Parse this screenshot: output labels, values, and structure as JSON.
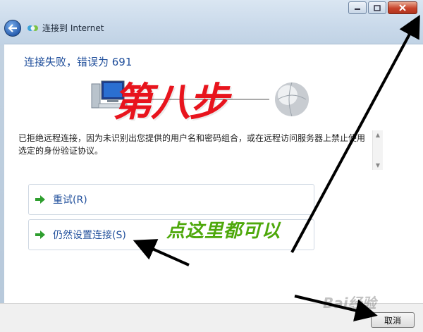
{
  "window": {
    "title": "连接到 Internet",
    "minimize_icon": "minimize-icon",
    "maximize_icon": "maximize-icon",
    "close_icon": "close-icon"
  },
  "page": {
    "heading": "连接失败，错误为 691",
    "message": "已拒绝远程连接，因为未识别出您提供的用户名和密码组合，或在远程访问服务器上禁止使用选定的身份验证协议。",
    "options": [
      {
        "label": "重试(R)",
        "icon": "green-arrow-icon"
      },
      {
        "label": "仍然设置连接(S)",
        "icon": "green-arrow-icon"
      }
    ],
    "cancel_label": "取消"
  },
  "annotations": {
    "step_text": "第八步",
    "hint_text": "点这里都可以"
  },
  "watermark": "Bai经验",
  "colors": {
    "heading": "#1f4e9b",
    "step_text": "#e8141d",
    "hint_text": "#4ea80b",
    "arrow": "#000000"
  }
}
